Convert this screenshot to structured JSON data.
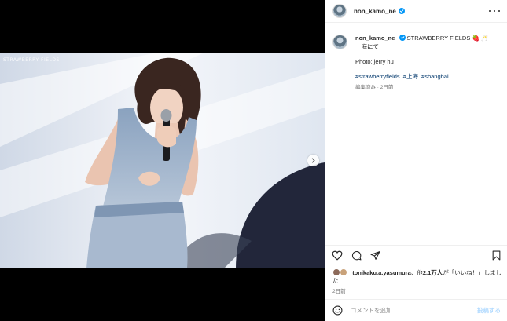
{
  "post": {
    "username": "non_kamo_ne",
    "caption_title": "STRAWBERRY FIELDS",
    "caption_emojis": "🍓 🥂",
    "caption_line2": "上海にて",
    "caption_photo_credit": "Photo: jerry hu",
    "hashtags": [
      "#strawberryfields",
      "#上海",
      "#shanghai"
    ],
    "edited_meta": "編集済み · 2日前",
    "likes_user": "tonikaku.a.yasumura",
    "likes_text_mid": "、他",
    "likes_count": "2.1万人",
    "likes_text_end": "が「いいね！」しました",
    "time_ago": "2日前"
  },
  "comment": {
    "placeholder": "コメントを追加...",
    "post_label": "投稿する"
  },
  "media": {
    "watermark": "STRAWBERRY FIELDS"
  },
  "colors": {
    "verified": "#0095f6",
    "link": "#00376b",
    "post_button_disabled": "#b3dbff"
  },
  "icons": [
    "verified-badge-icon",
    "more-options-icon",
    "heart-icon",
    "comment-icon",
    "share-icon",
    "bookmark-icon",
    "emoji-icon",
    "chevron-right-icon"
  ]
}
